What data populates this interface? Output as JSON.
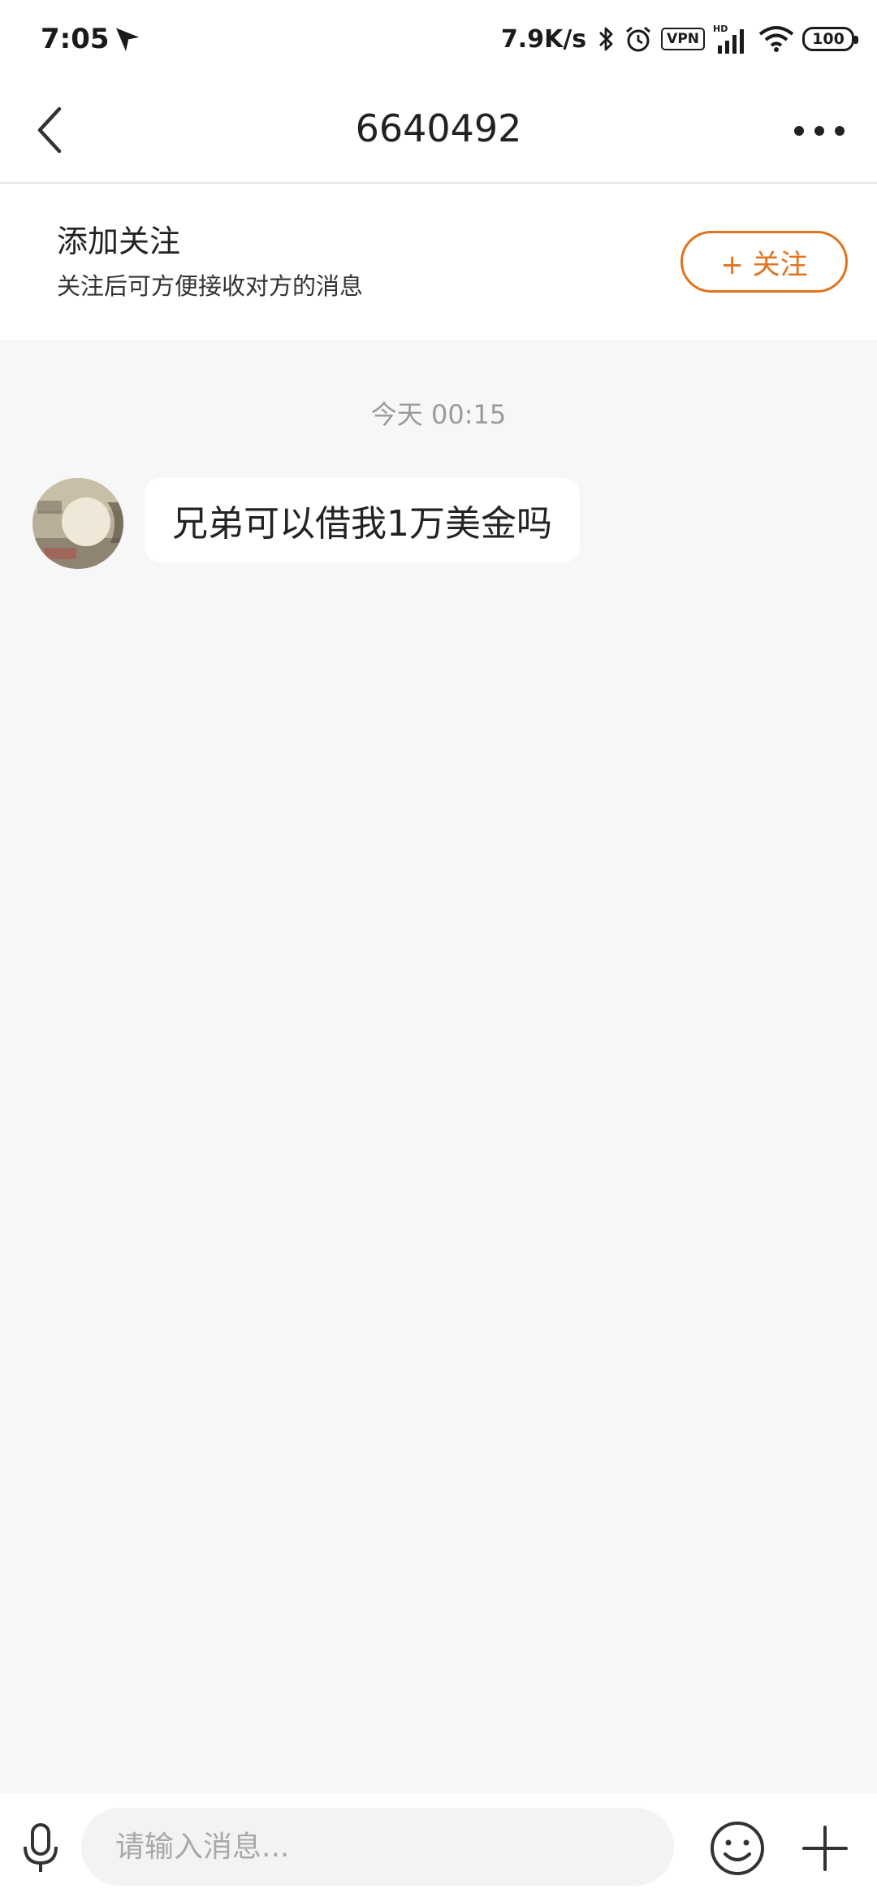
{
  "status_bar": {
    "time": "7:05",
    "net_speed": "7.9K/s",
    "vpn_label": "VPN",
    "hd_label": "HD",
    "battery": "100",
    "icons": [
      "send-icon",
      "bluetooth-icon",
      "alarm-icon",
      "vpn-icon",
      "signal-icon",
      "wifi-icon",
      "battery-icon"
    ]
  },
  "nav": {
    "title": "6640492",
    "icons": [
      "back-icon",
      "more-icon"
    ]
  },
  "follow_banner": {
    "title": "添加关注",
    "subtitle": "关注后可方便接收对方的消息",
    "button_label": "+ 关注",
    "accent_color": "#e2731c"
  },
  "chat": {
    "timestamp": "今天 00:15",
    "messages": [
      {
        "sender": "other",
        "text": "兄弟可以借我1万美金吗"
      }
    ]
  },
  "input_bar": {
    "placeholder": "请输入消息...",
    "value": "",
    "icons": [
      "microphone-icon",
      "emoji-icon",
      "plus-icon"
    ]
  }
}
